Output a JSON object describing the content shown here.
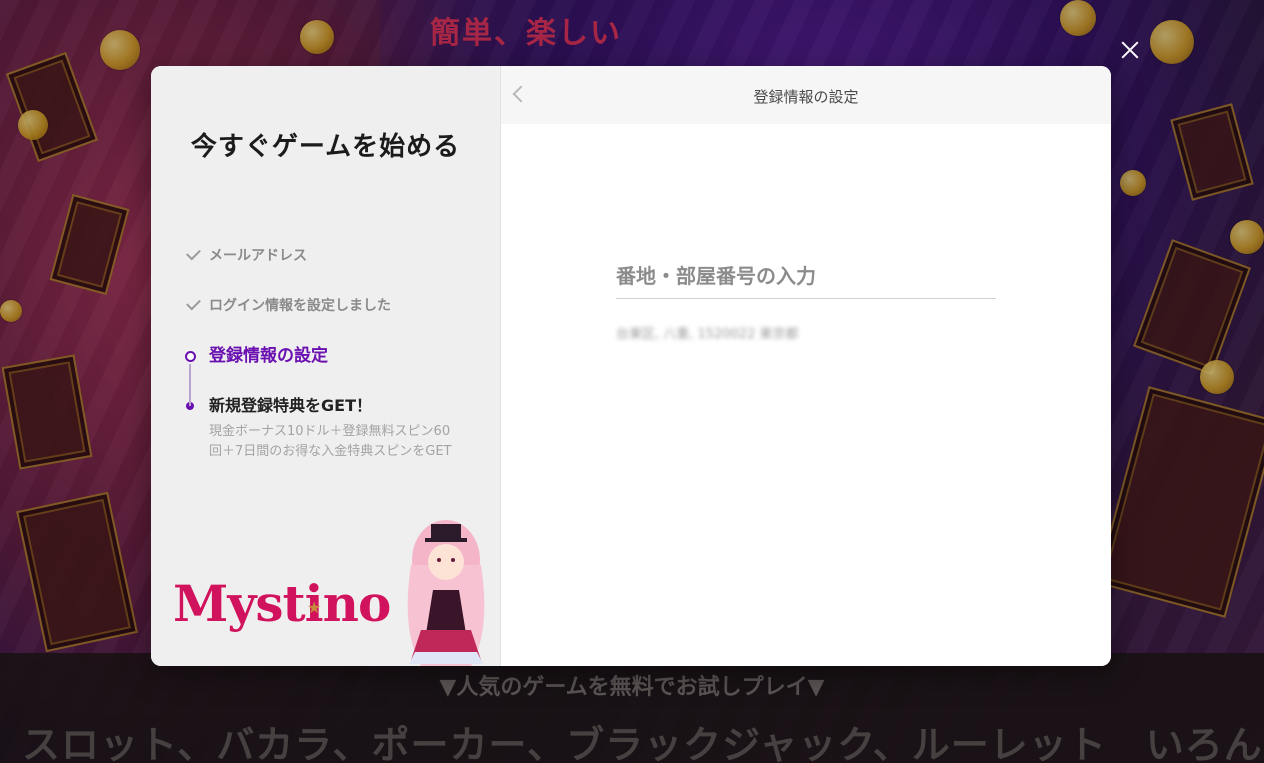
{
  "background": {
    "headline": "簡単、楽しい",
    "tagline": "▼人気のゲームを無料でお試しプレイ▼",
    "games_line": "スロット、バカラ、ポーカー、ブラックジャック、ルーレット　いろんな種"
  },
  "modal": {
    "close_icon": "close-icon",
    "left": {
      "title": "今すぐゲームを始める",
      "steps": [
        {
          "label": "メールアドレス",
          "state": "done"
        },
        {
          "label": "ログイン情報を設定しました",
          "state": "done"
        },
        {
          "label": "登録情報の設定",
          "state": "active"
        },
        {
          "label": "新規登録特典をGET！",
          "state": "next",
          "description": "現金ボーナス10ドル＋登録無料スピン60回＋7日間のお得な入金特典スピンをGET"
        }
      ],
      "logo": "Mystino"
    },
    "right": {
      "header_title": "登録情報の設定",
      "back_icon": "chevron-left-icon",
      "address_field": {
        "placeholder": "番地・部屋番号の入力",
        "value": ""
      },
      "address_hint": "台東区, 八重, 1520022 東京都"
    }
  },
  "colors": {
    "accent": "#6a0fb0",
    "brand": "#d1135d",
    "background_pink": "#a8345a",
    "background_purple": "#5a1f9a"
  }
}
